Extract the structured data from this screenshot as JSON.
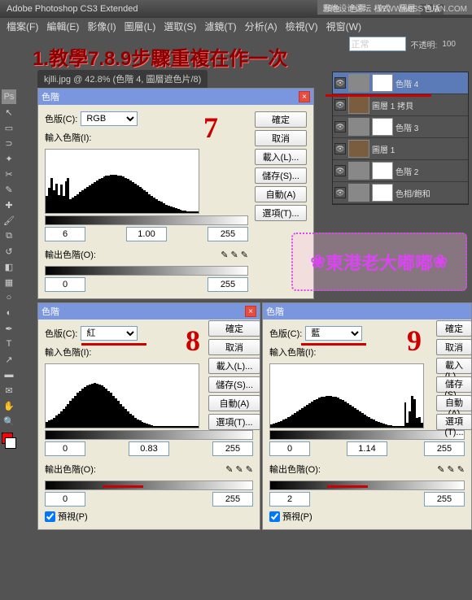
{
  "app": {
    "title": "Adobe Photoshop CS3 Extended"
  },
  "menu": {
    "file": "檔案(F)",
    "edit": "編輯(E)",
    "image": "影像(I)",
    "layer": "圖層(L)",
    "select": "選取(S)",
    "filter": "濾鏡(T)",
    "analysis": "分析(A)",
    "view": "檢視(V)",
    "window": "視窗(W)"
  },
  "tabs": {
    "color": "顏色",
    "swatches": "色票",
    "styles": "樣式",
    "layers": "圖層",
    "paths": "色版"
  },
  "watermark": "思缘设计论坛 - WWW.MISSYUAN.COM",
  "doc": {
    "name": "kjlli.jpg @ 42.8% (色階 4, 圖層遮色片/8)"
  },
  "annotation": "1.教學7.8.9步驟重複在作一次",
  "options": {
    "blend": "正常",
    "opacity_label": "不透明:",
    "opacity_val": "100"
  },
  "levels7": {
    "title": "色階",
    "channel_label": "色版(C):",
    "channel": "RGB",
    "input_label": "輸入色階(I):",
    "output_label": "輸出色階(O):",
    "in_low": "6",
    "in_gamma": "1.00",
    "in_high": "255",
    "out_low": "0",
    "out_high": "255",
    "ok": "確定",
    "cancel": "取消",
    "load": "載入(L)...",
    "save": "儲存(S)...",
    "auto": "自動(A)",
    "options": "選項(T)..."
  },
  "levels8": {
    "title": "色階",
    "channel_label": "色版(C):",
    "channel": "紅",
    "input_label": "輸入色階(I):",
    "output_label": "輸出色階(O):",
    "in_low": "0",
    "in_gamma": "0.83",
    "in_high": "255",
    "out_low": "0",
    "out_high": "255",
    "ok": "確定",
    "cancel": "取消",
    "load": "載入(L)...",
    "save": "儲存(S)...",
    "auto": "自動(A)",
    "options": "選項(T)...",
    "preview": "預視(P)"
  },
  "levels9": {
    "title": "色階",
    "channel_label": "色版(C):",
    "channel": "藍",
    "input_label": "輸入色階(I):",
    "output_label": "輸出色階(O):",
    "in_low": "0",
    "in_gamma": "1.14",
    "in_high": "255",
    "out_low": "2",
    "out_high": "255",
    "ok": "確定",
    "cancel": "取消",
    "load": "載入(L)...",
    "save": "儲存(S)...",
    "auto": "自動(A)",
    "options": "選項(T)...",
    "preview": "預視(P)"
  },
  "layers": {
    "l4": "色階 4",
    "l3a": "圖層 1 拷貝",
    "l3": "色階 3",
    "l1": "圖層 1",
    "l2": "色階 2",
    "hue": "色相/飽和"
  },
  "red_numbers": {
    "n7": "7",
    "n8": "8",
    "n9": "9"
  },
  "stamp": "東港老大嘟嘟",
  "chart_data": [
    {
      "type": "histogram",
      "title": "色階 RGB",
      "xlim": [
        0,
        255
      ],
      "in": [
        6,
        1.0,
        255
      ],
      "out": [
        0,
        255
      ]
    },
    {
      "type": "histogram",
      "title": "色階 紅",
      "xlim": [
        0,
        255
      ],
      "in": [
        0,
        0.83,
        255
      ],
      "out": [
        0,
        255
      ]
    },
    {
      "type": "histogram",
      "title": "色階 藍",
      "xlim": [
        0,
        255
      ],
      "in": [
        0,
        1.14,
        255
      ],
      "out": [
        2,
        255
      ]
    }
  ]
}
